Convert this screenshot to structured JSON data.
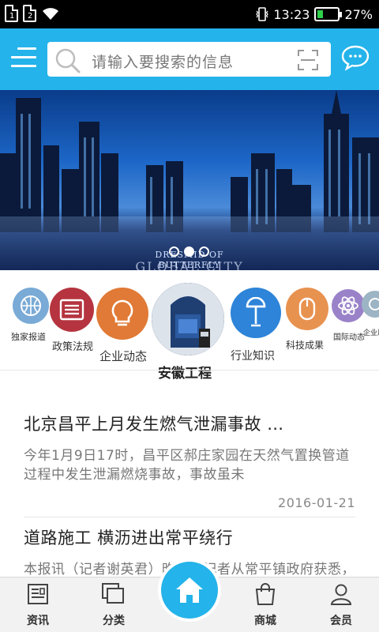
{
  "status_bar": {
    "sim1": "1",
    "sim2": "2",
    "time": "13:23",
    "battery_percent": "27%",
    "battery_level": 0.27,
    "icons": [
      "sim-card-icon",
      "wifi-icon",
      "vibrate-icon",
      "battery-icon"
    ]
  },
  "header": {
    "search_placeholder": "请输入要搜索的信息",
    "accent_color": "#24b3ea",
    "icons": [
      "menu-icon",
      "search-icon",
      "scan-icon",
      "chat-icon"
    ]
  },
  "banner": {
    "brand_line1": "DRESMID OF BUTTERFLY",
    "brand_line2": "GLOBAL CITY",
    "slides_total": 3,
    "active_slide": 2
  },
  "categories": [
    {
      "label": "独家报道",
      "color": "#7aaad6",
      "icon": "basketball-icon"
    },
    {
      "label": "政策法规",
      "color": "#b5343f",
      "icon": "newspaper-icon"
    },
    {
      "label": "企业动态",
      "color": "#e07a36",
      "icon": "lightbulb-icon"
    },
    {
      "label": "安徽工程",
      "color": "#1f3f73",
      "icon": "backpack-photo-icon"
    },
    {
      "label": "行业知识",
      "color": "#2d84d8",
      "icon": "microphone-icon"
    },
    {
      "label": "科技成果",
      "color": "#e89250",
      "icon": "mouse-icon"
    },
    {
      "label": "国际动态",
      "color": "#9a82c9",
      "icon": "atom-icon"
    },
    {
      "label": "企业风采",
      "color": "#9cb4c4",
      "icon": "circle-icon"
    }
  ],
  "news": [
    {
      "title": "北京昌平上月发生燃气泄漏事故 …",
      "summary": "今年1月9日17时，昌平区郝庄家园在天然气置换管道过程中发生泄漏燃烧事故，事故虽未",
      "date": "2016-01-21"
    },
    {
      "title": "道路施工 横沥进出常平绕行",
      "summary": "本报讯（记者谢英君）昨日，记者从常平镇政府获悉，因常平镇……"
    }
  ],
  "bottom_nav": {
    "tabs": [
      {
        "label": "资讯",
        "icon": "news-icon"
      },
      {
        "label": "分类",
        "icon": "category-icon"
      },
      {
        "label": "",
        "icon": "home-icon"
      },
      {
        "label": "商城",
        "icon": "shopping-bag-icon"
      },
      {
        "label": "会员",
        "icon": "user-icon"
      }
    ]
  }
}
